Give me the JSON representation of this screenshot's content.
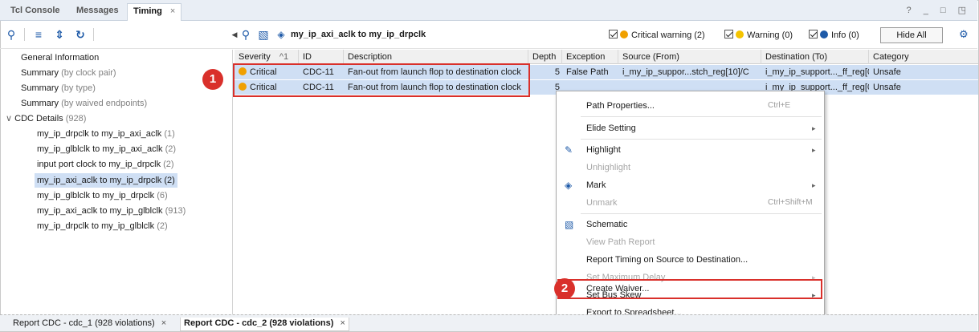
{
  "top_tabs": [
    {
      "label": "Tcl Console"
    },
    {
      "label": "Messages"
    },
    {
      "label": "Timing",
      "close": "×"
    }
  ],
  "window_controls": "? _ □ ◳",
  "right_toolbar": {
    "title": "my_ip_axi_aclk to my_ip_drpclk",
    "filters": [
      {
        "label": "Critical warning (2)",
        "color": "#f0a000"
      },
      {
        "label": "Warning (0)",
        "color": "#f5c400"
      },
      {
        "label": "Info (0)",
        "color": "#1e5aa8"
      }
    ],
    "hide_all": "Hide All"
  },
  "tree": {
    "items": [
      {
        "label": "General Information",
        "count": ""
      },
      {
        "label": "Summary",
        "count": "(by clock pair)"
      },
      {
        "label": "Summary",
        "count": "(by type)"
      },
      {
        "label": "Summary",
        "count": "(by waived endpoints)"
      },
      {
        "label": "CDC Details",
        "count": "(928)",
        "arrow": "∨"
      },
      {
        "label": "my_ip_drpclk to my_ip_axi_aclk",
        "count": "(1)"
      },
      {
        "label": "my_ip_glblclk to my_ip_axi_aclk",
        "count": "(2)"
      },
      {
        "label": "input port clock to my_ip_drpclk",
        "count": "(2)"
      },
      {
        "label": "my_ip_axi_aclk to my_ip_drpclk (2)",
        "count": ""
      },
      {
        "label": "my_ip_glblclk to my_ip_drpclk",
        "count": "(6)"
      },
      {
        "label": "my_ip_axi_aclk to my_ip_glblclk",
        "count": "(913)"
      },
      {
        "label": "my_ip_drpclk to my_ip_glblclk",
        "count": "(2)"
      }
    ]
  },
  "grid": {
    "columns": [
      "Severity",
      "ID",
      "Description",
      "Depth",
      "Exception",
      "Source (From)",
      "Destination (To)",
      "Category"
    ],
    "sort_indicator": "^1",
    "rows": [
      {
        "severity": "Critical",
        "id": "CDC-11",
        "description": "Fan-out from launch flop to destination clock",
        "depth": "5",
        "exception": "False Path",
        "source": "i_my_ip_suppor...stch_reg[10]/C",
        "destination": "i_my_ip_support..._ff_reg[0]/CLR",
        "category": "Unsafe"
      },
      {
        "severity": "Critical",
        "id": "CDC-11",
        "description": "Fan-out from launch flop to destination clock",
        "depth": "5",
        "exception": "",
        "source": "",
        "destination": "i_my_ip_support..._ff_reg[0]/CLR",
        "category": "Unsafe"
      }
    ]
  },
  "badges": [
    "1",
    "2"
  ],
  "context_menu": {
    "items": [
      {
        "label": "Path Properties...",
        "shortcut": "Ctrl+E"
      },
      {
        "label": "Elide Setting",
        "arrow": "▸"
      },
      {
        "label": "Highlight",
        "arrow": "▸"
      },
      {
        "label": "Unhighlight"
      },
      {
        "label": "Mark",
        "arrow": "▸"
      },
      {
        "label": "Unmark",
        "shortcut": "Ctrl+Shift+M"
      },
      {
        "label": "Schematic"
      },
      {
        "label": "View Path Report"
      },
      {
        "label": "Report Timing on Source to Destination..."
      },
      {
        "label": "Set Maximum Delay",
        "arrow": "▸"
      },
      {
        "label": "Set Bus Skew",
        "arrow": "▸"
      },
      {
        "label": "Create Waiver..."
      },
      {
        "label": "Export to Spreadsheet..."
      }
    ]
  },
  "bottom_tabs": [
    {
      "label": "Report CDC - cdc_1 (928 violations)",
      "close": "×"
    },
    {
      "label": "Report CDC - cdc_2 (928 violations)",
      "close": "×"
    }
  ]
}
